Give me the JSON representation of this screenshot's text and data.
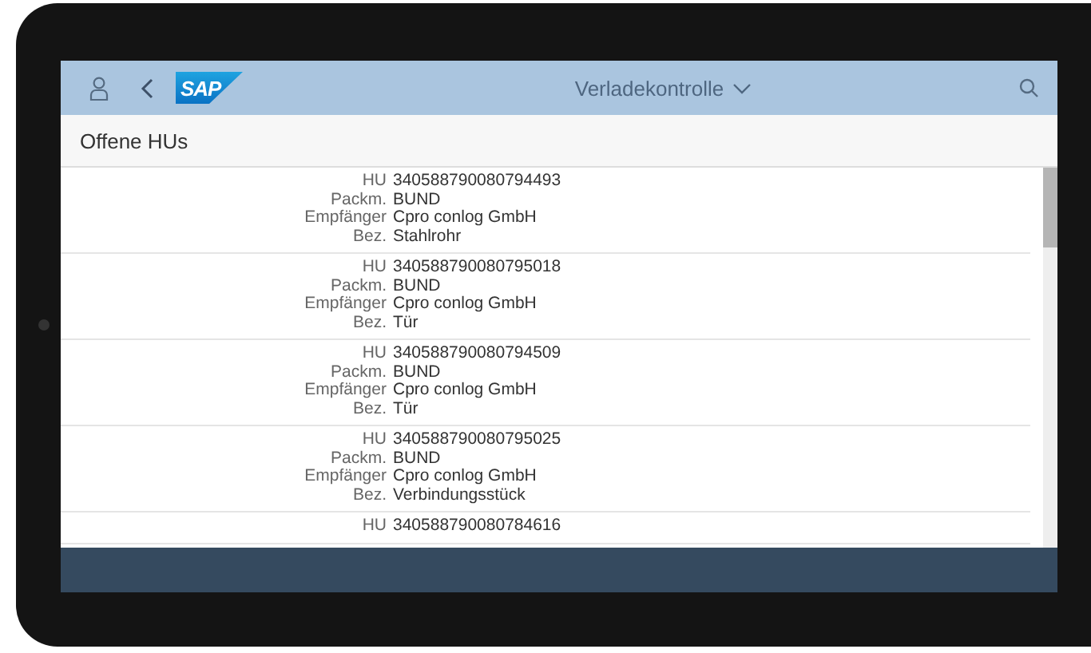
{
  "header": {
    "logo": "SAP",
    "title": "Verladekontrolle"
  },
  "page": {
    "title": "Offene HUs"
  },
  "items": [
    {
      "fields": [
        {
          "label": "HU",
          "value": "340588790080794493"
        },
        {
          "label": "Packm.",
          "value": "BUND"
        },
        {
          "label": "Empfänger",
          "value": "Cpro conlog GmbH"
        },
        {
          "label": "Bez.",
          "value": "Stahlrohr"
        }
      ]
    },
    {
      "fields": [
        {
          "label": "HU",
          "value": "340588790080795018"
        },
        {
          "label": "Packm.",
          "value": "BUND"
        },
        {
          "label": "Empfänger",
          "value": "Cpro conlog GmbH"
        },
        {
          "label": "Bez.",
          "value": "Tür"
        }
      ]
    },
    {
      "fields": [
        {
          "label": "HU",
          "value": "340588790080794509"
        },
        {
          "label": "Packm.",
          "value": "BUND"
        },
        {
          "label": "Empfänger",
          "value": "Cpro conlog GmbH"
        },
        {
          "label": "Bez.",
          "value": "Tür"
        }
      ]
    },
    {
      "fields": [
        {
          "label": "HU",
          "value": "340588790080795025"
        },
        {
          "label": "Packm.",
          "value": "BUND"
        },
        {
          "label": "Empfänger",
          "value": "Cpro conlog GmbH"
        },
        {
          "label": "Bez.",
          "value": "Verbindungsstück"
        }
      ]
    },
    {
      "fields": [
        {
          "label": "HU",
          "value": "340588790080784616"
        }
      ]
    }
  ]
}
